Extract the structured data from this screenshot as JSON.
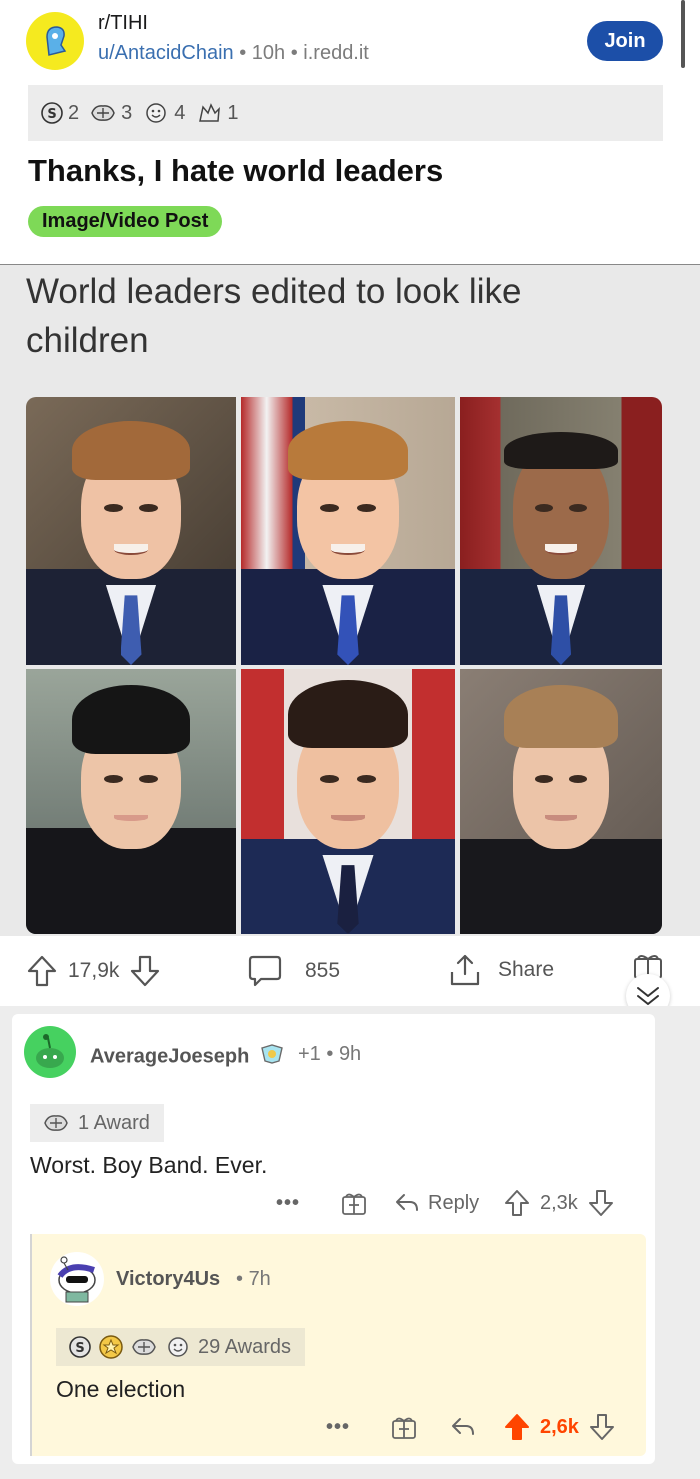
{
  "post": {
    "subreddit": "r/TIHI",
    "author": "u/AntacidChain",
    "time": "10h",
    "domain": "i.redd.it",
    "join_label": "Join",
    "awards": [
      {
        "icon": "silver-award-icon",
        "count": "2"
      },
      {
        "icon": "helpful-award-icon",
        "count": "3"
      },
      {
        "icon": "wholesome-award-icon",
        "count": "4"
      },
      {
        "icon": "hugz-award-icon",
        "count": "1"
      }
    ],
    "title": "Thanks, I hate world leaders",
    "flair": "Image/Video Post",
    "image_caption": "World leaders edited to look like children",
    "upvotes": "17,9k",
    "comments": "855",
    "share_label": "Share"
  },
  "comment": {
    "user": "AverageJoeseph",
    "karma": "+1",
    "time": "9h",
    "award_label": "1 Award",
    "text": "Worst. Boy Band. Ever.",
    "more": "•••",
    "reply_label": "Reply",
    "score": "2,3k"
  },
  "reply": {
    "user": "Victory4Us",
    "time": "7h",
    "awards_label": "29 Awards",
    "text": "One election",
    "more": "•••",
    "score": "2,6k"
  },
  "colors": {
    "join_bg": "#1c4fa8",
    "flair_bg": "#7ed957",
    "upvote_active": "#ff4500",
    "reply_bg": "#fff8dc"
  }
}
